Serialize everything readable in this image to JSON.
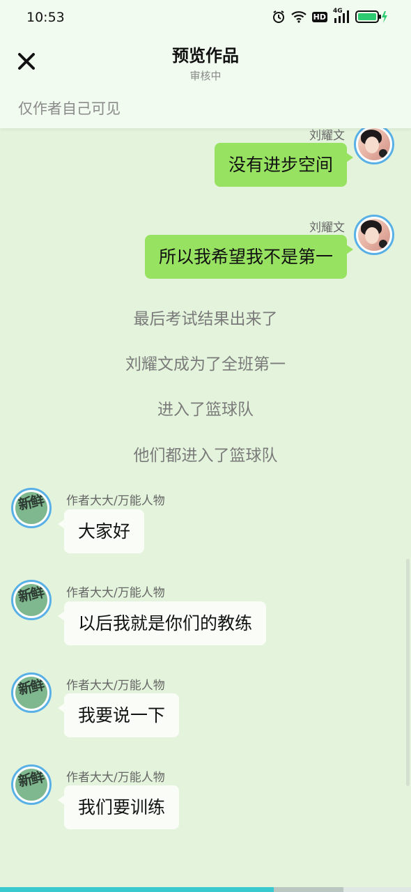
{
  "status_bar": {
    "time": "10:53",
    "icons": [
      "alarm-icon",
      "wifi-icon",
      "hd-icon",
      "signal-4g-icon",
      "battery-charging-icon"
    ],
    "hd_label": "HD",
    "network_label": "4G"
  },
  "header": {
    "close_icon": "close-icon",
    "title": "预览作品",
    "subtitle": "审核中",
    "visibility_note": "仅作者自己可见"
  },
  "messages": [
    {
      "side": "right",
      "speaker": "刘耀文",
      "text": "没有进步空间"
    },
    {
      "side": "right",
      "speaker": "刘耀文",
      "text": "所以我希望我不是第一"
    }
  ],
  "narration": [
    "最后考试结果出来了",
    "刘耀文成为了全班第一",
    "进入了篮球队",
    "他们都进入了篮球队"
  ],
  "left_messages": [
    {
      "speaker": "作者大大/万能人物",
      "text": "大家好",
      "avatar_glyph": "新鲜"
    },
    {
      "speaker": "作者大大/万能人物",
      "text": "以后我就是你们的教练",
      "avatar_glyph": "新鲜"
    },
    {
      "speaker": "作者大大/万能人物",
      "text": "我要说一下",
      "avatar_glyph": "新鲜"
    },
    {
      "speaker": "作者大大/万能人物",
      "text": "我们要训练",
      "avatar_glyph": "新鲜"
    }
  ],
  "colors": {
    "page_bg": "#e4f4dc",
    "header_bg": "#f1fbef",
    "bubble_right": "#98e262",
    "bubble_left": "#fafdf7",
    "avatar_border": "#58b0e6",
    "progress": "#3bc9d0"
  },
  "reading_progress": 0.67
}
